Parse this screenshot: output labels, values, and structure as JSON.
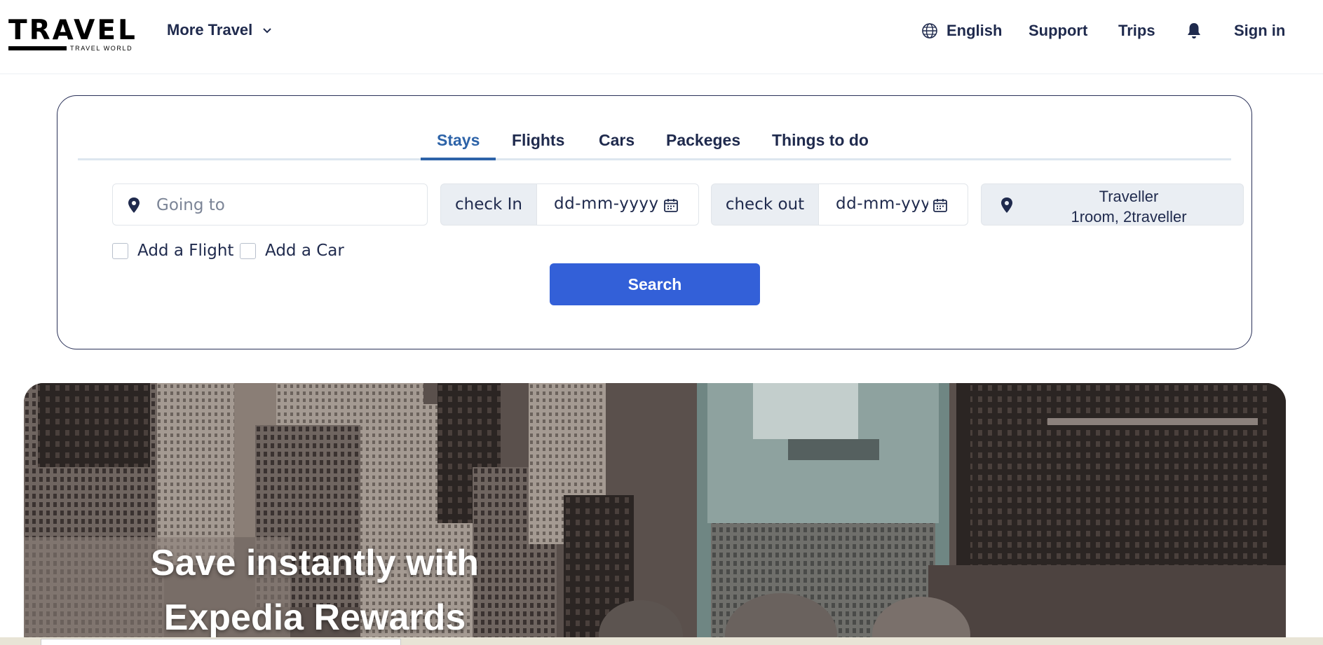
{
  "header": {
    "logo_text": "TRAVEL",
    "logo_subtext": "TRAVEL WORLD",
    "more_travel": "More Travel",
    "language": "English",
    "support": "Support",
    "trips": "Trips",
    "sign_in": "Sign in"
  },
  "search": {
    "tabs": [
      {
        "label": "Stays",
        "active": true
      },
      {
        "label": "Flights",
        "active": false
      },
      {
        "label": "Cars",
        "active": false
      },
      {
        "label": "Packeges",
        "active": false
      },
      {
        "label": "Things to do",
        "active": false
      }
    ],
    "going_to_placeholder": "Going to",
    "check_in_label": "check In",
    "check_in_value": "dd-mm-yyyy",
    "check_out_label": "check out",
    "check_out_value": "dd-mm-yyyy",
    "traveller_title": "Traveller",
    "traveller_value": "1room, 2traveller",
    "add_flight": "Add a Flight",
    "add_car": "Add a Car",
    "search_button": "Search"
  },
  "hero": {
    "title_line1": "Save instantly with",
    "title_line2": "Expedia Rewards"
  },
  "colors": {
    "accent": "#3360d8",
    "active_tab": "#2d63a8",
    "text": "#1f2a4d",
    "field_bg": "#eaeef3"
  },
  "icons": {
    "more_travel": "chevron-down-icon",
    "language": "globe-icon",
    "notifications": "bell-icon",
    "location": "map-pin-icon",
    "date": "calendar-icon"
  }
}
